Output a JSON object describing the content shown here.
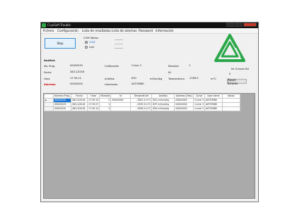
{
  "window": {
    "title": "CryoSoft Trouble"
  },
  "menu": [
    "Fichero",
    "Configuración",
    "Lista de resultados",
    "Lista de alarmas",
    "Password",
    "Información"
  ],
  "com": {
    "label": "COM Status",
    "stop": "Stop",
    "com": "COM",
    "link": "Link",
    "selected": "COM"
  },
  "analisis": {
    "heading": "Análisis",
    "no_prog_label": "No. Prog.",
    "no_prog": "00002030",
    "fecha_label": "Fecha",
    "fecha": "28/11/2018",
    "hora_label": "Hora",
    "hora": "17:30:14",
    "alarmas_label": "Alarmas",
    "alarmas": "00000000",
    "calibracion_label": "Calibración",
    "calibracion": "Curve 3",
    "muestra_label": "Muestra",
    "muestra": "1",
    "id_label": "ID",
    "analisis_label": "Análisis",
    "analisis_val": "830",
    "analisis_unit": "mOsm/kg",
    "temperatura_label": "Temperatura",
    "temperatura": "-1556.5",
    "temp_unit": "m°C",
    "username_label": "Username",
    "username": "ASTORIBS"
  },
  "errors": {
    "label": "Nr. Errores RX",
    "value": "0",
    "reset": "Reset Errores"
  },
  "grid": {
    "columns": [
      "Número Prog.",
      "Fecha",
      "Hora",
      "Muestra",
      "Id",
      "Temperature",
      "Análisis",
      "Alarmas [Hex]",
      "Curve",
      "User name",
      "Notas"
    ],
    "rows": [
      [
        "00002030",
        "28/11/2018",
        "17:30:15",
        "1",
        "00000000",
        "-1561.5 m°C",
        "841 mOsm/kg",
        "00000000",
        "Curve 3",
        "ASTORIBS",
        ""
      ],
      [
        "00002029",
        "28/11/2018",
        "17:33:27",
        "1",
        "",
        "-1555.9 m°C",
        "837 mOsm/kg",
        "00000000",
        "Curve 3",
        "ASTORIBS",
        ""
      ],
      [
        "00002030",
        "28/11/2018",
        "17:30:14",
        "1",
        "",
        "-1556.5 m°C",
        "830 mOsm/kg",
        "00000000",
        "Curve 3",
        "ASTORIBS",
        ""
      ]
    ],
    "current_marker": "►"
  },
  "colors": {
    "accent": "#1e78d7",
    "logo": "#2aa84a",
    "alarm": "#d20000"
  }
}
